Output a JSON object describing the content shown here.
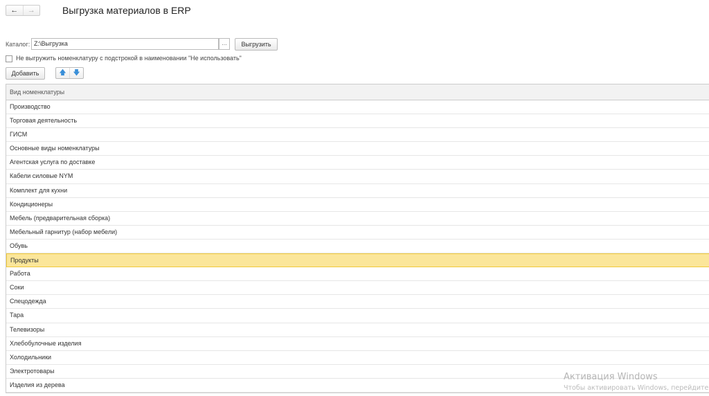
{
  "nav": {
    "back": "←",
    "forward": "→"
  },
  "title": "Выгрузка материалов в ERP",
  "catalog": {
    "label": "Каталог:",
    "value": "Z:\\Выгрузка",
    "browse": "...",
    "export_button": "Выгрузить"
  },
  "checkbox": {
    "label": "Не выгружить номенклатуру с подстрокой в наименовании \"Не использовать\"",
    "checked": false
  },
  "toolbar": {
    "add": "Добавить",
    "up": "🡅",
    "down": "🡇"
  },
  "table": {
    "header": "Вид номенклатуры",
    "selected_index": 11,
    "rows": [
      "Производство",
      "Торговая деятельность",
      "ГИСМ",
      "Основные виды номенклатуры",
      "Агентская услуга по доставке",
      "Кабели силовые NYM",
      "Комплект для кухни",
      "Кондиционеры",
      "Мебель (предварительная сборка)",
      "Мебельный гарнитур (набор мебели)",
      "Обувь",
      "Продукты",
      "Работа",
      "Соки",
      "Спецодежда",
      "Тара",
      "Телевизоры",
      "Хлебобулочные изделия",
      "Холодильники",
      "Электротовары",
      "Изделия из дерева"
    ]
  },
  "watermark": {
    "title": "Активация Windows",
    "subtitle": "Чтобы активировать Windows, перейдите в"
  }
}
